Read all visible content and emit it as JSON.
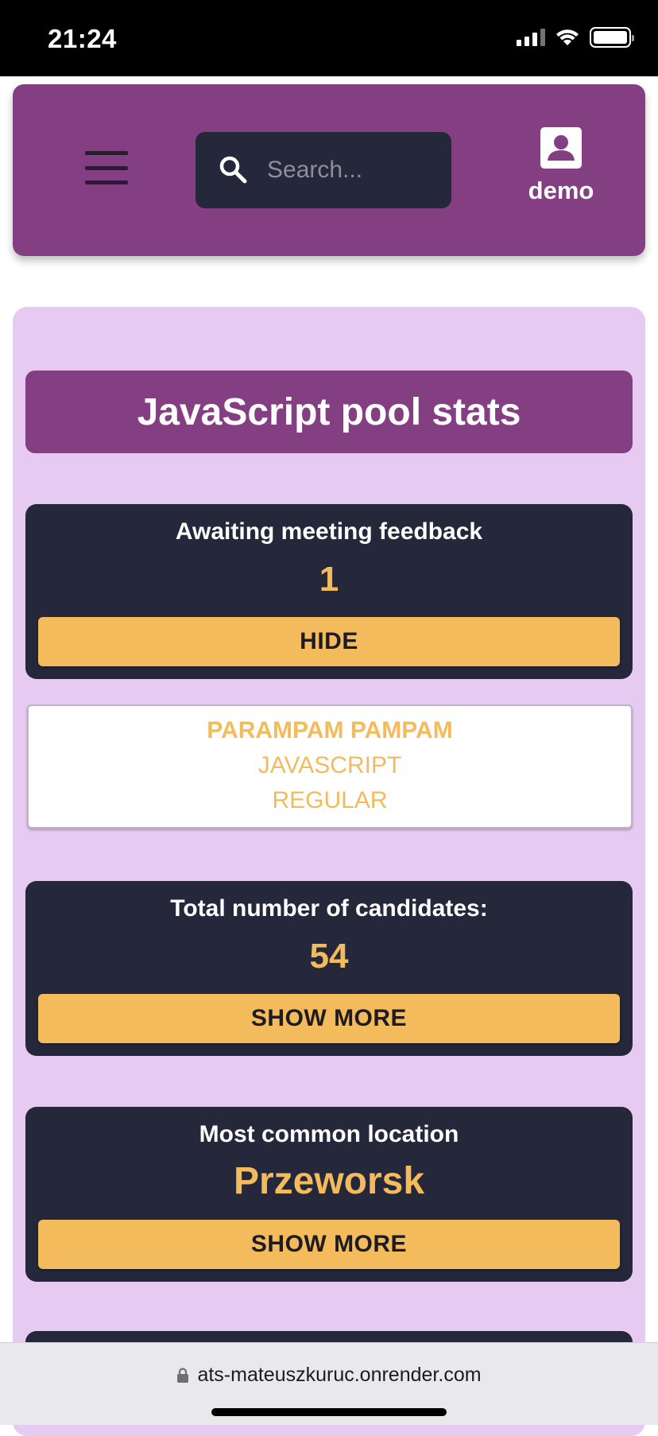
{
  "status_bar": {
    "time": "21:24"
  },
  "header": {
    "search_placeholder": "Search...",
    "user_name": "demo"
  },
  "page": {
    "title": "JavaScript pool stats"
  },
  "stats": [
    {
      "label": "Awaiting meeting feedback",
      "value": "1",
      "button": "HIDE"
    },
    {
      "label": "Total number of candidates:",
      "value": "54",
      "button": "SHOW MORE"
    },
    {
      "label": "Most common location",
      "value": "Przeworsk",
      "button": "SHOW MORE"
    }
  ],
  "candidate": {
    "name": "PARAMPAM PAMPAM",
    "technology": "JAVASCRIPT",
    "level": "REGULAR"
  },
  "browser": {
    "url": "ats-mateuszkuruc.onrender.com"
  },
  "colors": {
    "brand_purple": "#843f83",
    "panel_lavender": "#e6caf1",
    "card_dark": "#25273a",
    "accent_yellow": "#f3bb5c"
  },
  "icons": [
    "menu-icon",
    "search-icon",
    "user-account-icon",
    "lock-icon",
    "signal-icon",
    "wifi-icon",
    "battery-icon"
  ]
}
